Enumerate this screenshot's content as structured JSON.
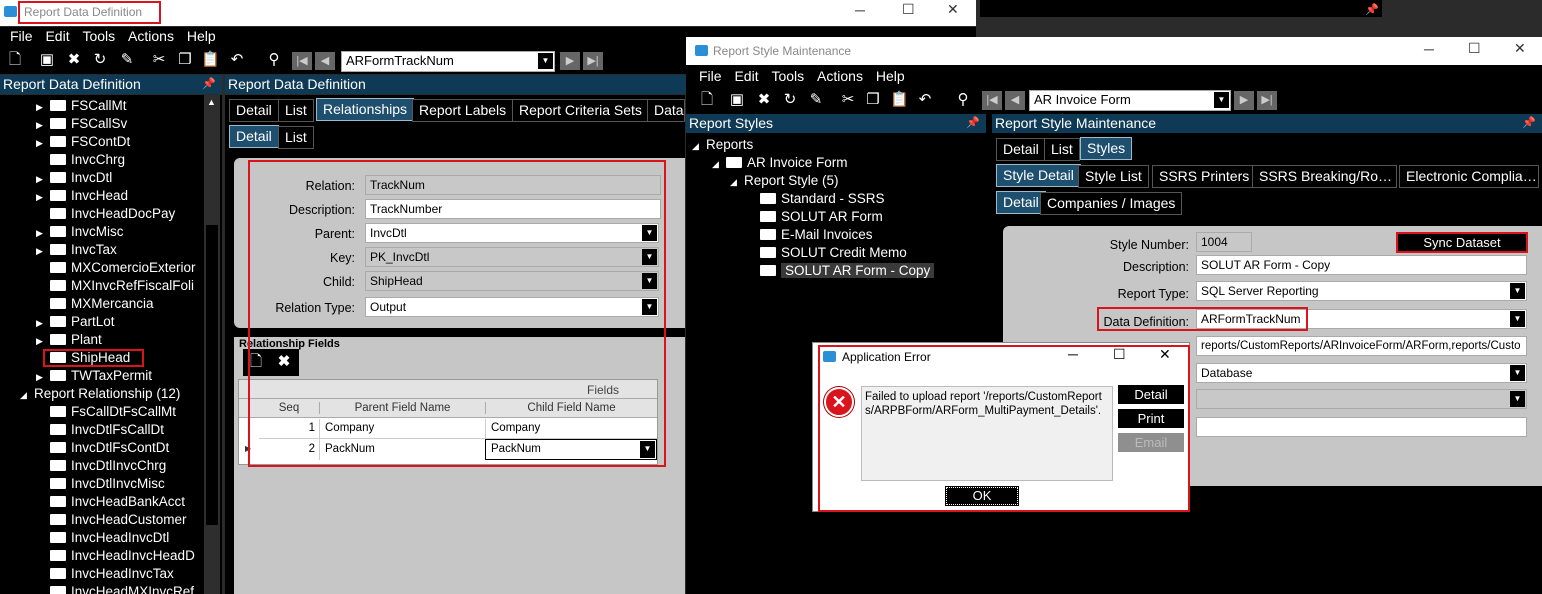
{
  "left_window": {
    "title": "Report Data Definition",
    "menu": [
      "File",
      "Edit",
      "Tools",
      "Actions",
      "Help"
    ],
    "nav_value": "ARFormTrackNum",
    "tree_header": "Report Data Definition",
    "main_header": "Report Data Definition",
    "tree_items": [
      {
        "label": "FSCallMt",
        "arrow": "▶"
      },
      {
        "label": "FSCallSv",
        "arrow": "▶"
      },
      {
        "label": "FSContDt",
        "arrow": "▶"
      },
      {
        "label": "InvcChrg",
        "arrow": ""
      },
      {
        "label": "InvcDtl",
        "arrow": "▶"
      },
      {
        "label": "InvcHead",
        "arrow": "▶"
      },
      {
        "label": "InvcHeadDocPay",
        "arrow": ""
      },
      {
        "label": "InvcMisc",
        "arrow": "▶"
      },
      {
        "label": "InvcTax",
        "arrow": "▶"
      },
      {
        "label": "MXComercioExterior",
        "arrow": ""
      },
      {
        "label": "MXInvcRefFiscalFoli",
        "arrow": ""
      },
      {
        "label": "MXMercancia",
        "arrow": ""
      },
      {
        "label": "PartLot",
        "arrow": "▶"
      },
      {
        "label": "Plant",
        "arrow": "▶"
      },
      {
        "label": "ShipHead",
        "arrow": ""
      },
      {
        "label": "TWTaxPermit",
        "arrow": "▶"
      }
    ],
    "relationship_group": "Report Relationship (12)",
    "relationship_items": [
      "FsCallDtFsCallMt",
      "InvcDtlFsCallDt",
      "InvcDtlFsContDt",
      "InvcDtlInvcChrg",
      "InvcDtlInvcMisc",
      "InvcHeadBankAcct",
      "InvcHeadCustomer",
      "InvcHeadInvcDtl",
      "InvcHeadInvcHeadD",
      "InvcHeadInvcTax",
      "InvcHeadMXInvcRef"
    ],
    "tabs": [
      "Detail",
      "List",
      "Relationships",
      "Report Labels",
      "Report Criteria Sets",
      "Data"
    ],
    "subtabs": [
      "Detail",
      "List"
    ],
    "form": {
      "relation_label": "Relation:",
      "relation": "TrackNum",
      "description_label": "Description:",
      "description": "TrackNumber",
      "parent_label": "Parent:",
      "parent": "InvcDtl",
      "key_label": "Key:",
      "key": "PK_InvcDtl",
      "child_label": "Child:",
      "child": "ShipHead",
      "relation_type_label": "Relation Type:",
      "relation_type": "Output"
    },
    "relationship_fields_title": "Relationship Fields",
    "grid": {
      "group_header": "Fields",
      "columns": [
        "Seq",
        "Parent Field Name",
        "Child Field Name"
      ],
      "rows": [
        {
          "seq": "1",
          "parent": "Company",
          "child": "Company"
        },
        {
          "seq": "2",
          "parent": "PackNum",
          "child": "PackNum"
        }
      ]
    }
  },
  "right_window": {
    "title": "Report Style Maintenance",
    "menu": [
      "File",
      "Edit",
      "Tools",
      "Actions",
      "Help"
    ],
    "nav_value": "AR Invoice Form",
    "tree_header": "Report Styles",
    "main_header": "Report Style Maintenance",
    "tree": {
      "root": "Reports",
      "form": "AR Invoice Form",
      "group": "Report Style (5)",
      "styles": [
        "Standard - SSRS",
        "SOLUT AR Form",
        "E-Mail Invoices",
        "SOLUT Credit Memo",
        "SOLUT AR Form - Copy"
      ]
    },
    "tabs": [
      "Detail",
      "List",
      "Styles"
    ],
    "subtabs": [
      "Style Detail",
      "Style List",
      "SSRS Printers",
      "SSRS  Breaking/Ro…",
      "Electronic  Complia…"
    ],
    "subsubtabs": [
      "Detail",
      "Companies / Images"
    ],
    "form": {
      "style_number_label": "Style Number:",
      "style_number": "1004",
      "sync_button": "Sync Dataset",
      "description_label": "Description:",
      "description": "SOLUT AR Form - Copy",
      "report_type_label": "Report Type:",
      "report_type": "SQL Server Reporting",
      "data_definition_label": "Data Definition:",
      "data_definition": "ARFormTrackNum",
      "report_path": "reports/CustomReports/ARInvoiceForm/ARForm,reports/Custo",
      "output_location": "Database",
      "extra_value": "",
      "extra_text": ""
    }
  },
  "error_dialog": {
    "title": "Application Error",
    "message": "Failed to upload report '/reports/CustomReports/ARPBForm/ARForm_MultiPayment_Details'.",
    "buttons": {
      "detail": "Detail",
      "print": "Print",
      "email": "Email",
      "ok": "OK"
    }
  },
  "colors": {
    "accent": "#d9141c",
    "header": "#0f3a56"
  }
}
